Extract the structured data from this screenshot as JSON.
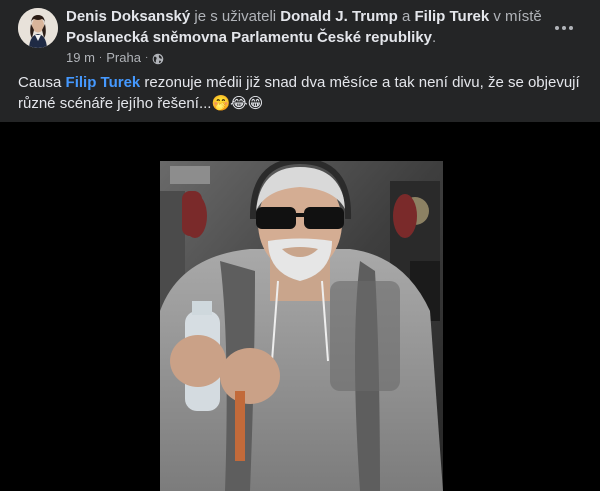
{
  "post": {
    "author": "Denis Doksanský",
    "with_text": " je s uživateli ",
    "tagged_1": "Donald J. Trump",
    "and_text": " a ",
    "tagged_2": "Filip Turek",
    "location_prefix": " v místě ",
    "location": "Poslanecká sněmovna Parlamentu České republiky",
    "location_suffix": ".",
    "time": "19 m",
    "separator": "·",
    "place": "Praha",
    "privacy_icon": "globe-icon",
    "text_before": "Causa ",
    "mention": "Filip Turek",
    "text_after": " rezonuje médii již snad dva měsíce a tak není divu, že se objevují různé scénáře jejího řešení...",
    "emojis": "🤭😂😁",
    "more_icon": "more-options-icon"
  },
  "colors": {
    "background": "#242526",
    "link": "#4599ff",
    "media_background": "#000000"
  }
}
